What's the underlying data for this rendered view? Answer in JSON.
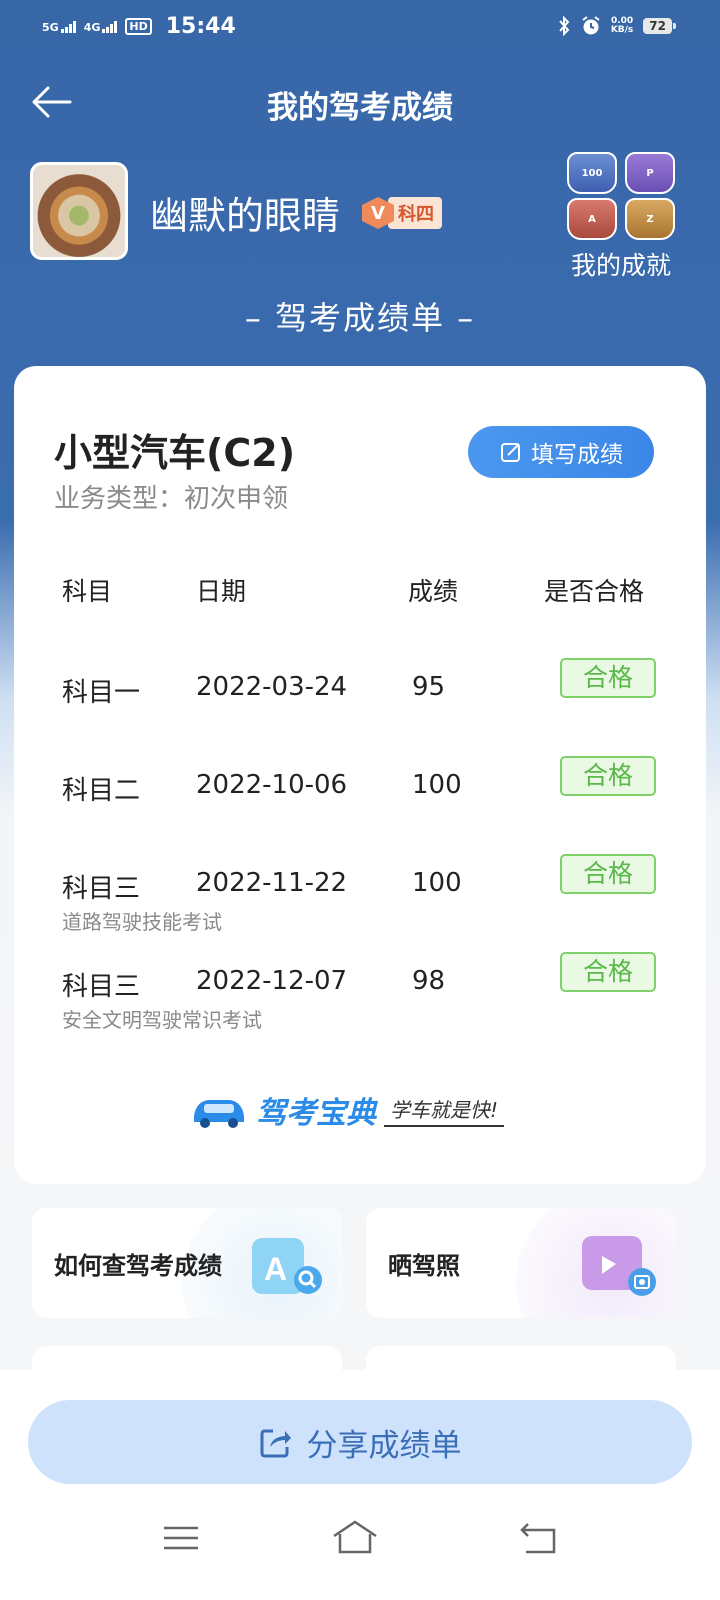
{
  "status_bar": {
    "sim1": "5G",
    "sim2": "4G",
    "hd": "HD",
    "time": "15:44",
    "net_speed_value": "0.00",
    "net_speed_unit": "KB/s",
    "battery": "72"
  },
  "header": {
    "title": "我的驾考成绩"
  },
  "profile": {
    "username": "幽默的眼睛",
    "vip_letter": "V",
    "vip_subject": "科四",
    "achievements_label": "我的成就",
    "medals": [
      "100",
      "P",
      "A",
      "Z"
    ]
  },
  "report_heading": "– 驾考成绩单 –",
  "card": {
    "vehicle": "小型汽车(C2)",
    "business_type": "业务类型：初次申领",
    "fill_button": "填写成绩",
    "columns": [
      "科目",
      "日期",
      "成绩",
      "是否合格"
    ],
    "rows": [
      {
        "subject": "科目一",
        "date": "2022-03-24",
        "score": "95",
        "status": "合格",
        "note": ""
      },
      {
        "subject": "科目二",
        "date": "2022-10-06",
        "score": "100",
        "status": "合格",
        "note": ""
      },
      {
        "subject": "科目三",
        "date": "2022-11-22",
        "score": "100",
        "status": "合格",
        "note": "道路驾驶技能考试"
      },
      {
        "subject": "科目三",
        "date": "2022-12-07",
        "score": "98",
        "status": "合格",
        "note": "安全文明驾驶常识考试"
      }
    ],
    "brand": "驾考宝典",
    "slogan": "学车就是快!"
  },
  "tiles": [
    {
      "label": "如何查驾考成绩",
      "icon": "search-document-icon"
    },
    {
      "label": "晒驾照",
      "icon": "photo-share-icon"
    }
  ],
  "share_button": "分享成绩单",
  "colors": {
    "header_blue": "#3867a8",
    "accent_blue": "#3c86e8",
    "pass_green": "#5ab84a",
    "share_bg": "#cfe2fb"
  }
}
